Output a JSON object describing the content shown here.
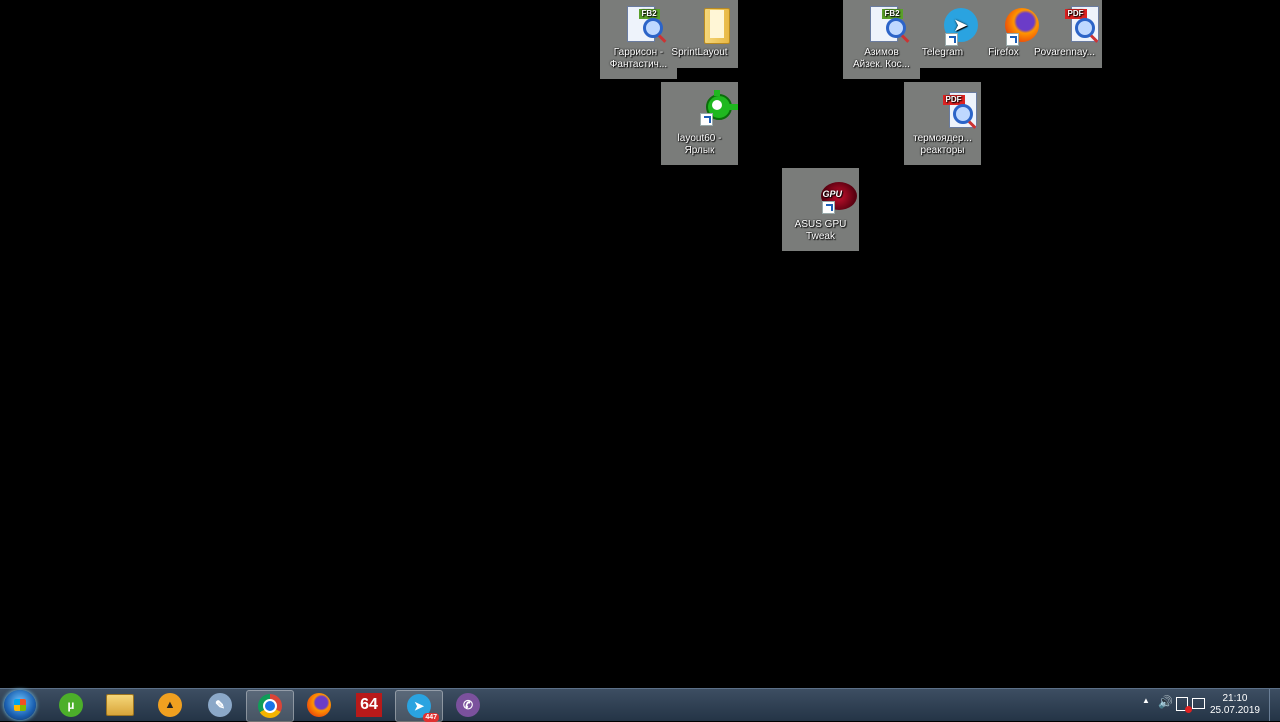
{
  "desktop": {
    "icons": [
      {
        "label1": "Гаррисон -",
        "label2": "Фантастич...",
        "type": "fb2"
      },
      {
        "label1": "SprintLayout",
        "label2": "",
        "type": "folder"
      },
      {
        "label1": "Азимов",
        "label2": "Айзек. Кос...",
        "type": "fb2"
      },
      {
        "label1": "Telegram",
        "label2": "",
        "type": "telegram"
      },
      {
        "label1": "Firefox",
        "label2": "",
        "type": "firefox"
      },
      {
        "label1": "Povarennay...",
        "label2": "",
        "type": "pdf"
      },
      {
        "label1": "layout60 -",
        "label2": "Ярлык",
        "type": "layout"
      },
      {
        "label1": "термоядер...",
        "label2": "реакторы",
        "type": "pdf"
      },
      {
        "label1": "ASUS GPU",
        "label2": "Tweak",
        "type": "gpu"
      }
    ],
    "badges": {
      "fb2": "FB2",
      "pdf": "PDF",
      "gpu": "GPU"
    }
  },
  "taskbar": {
    "pinned": [
      {
        "name": "utorrent",
        "glyph": "µ",
        "color": "#4caf2a"
      },
      {
        "name": "explorer",
        "glyph": "",
        "color": "#e8c054"
      },
      {
        "name": "aimp",
        "glyph": "▲",
        "color": "#f0a020"
      },
      {
        "name": "paint",
        "glyph": "✎",
        "color": "#8ba8c8"
      },
      {
        "name": "chrome",
        "glyph": "",
        "color": "#1a73e8"
      },
      {
        "name": "firefox",
        "glyph": "",
        "color": "#ff7a00"
      },
      {
        "name": "aida64",
        "glyph": "64",
        "color": "#b81a1a"
      },
      {
        "name": "telegram",
        "glyph": "➤",
        "color": "#2aa3e0"
      },
      {
        "name": "viber",
        "glyph": "✆",
        "color": "#7b519d"
      }
    ],
    "telegram_badge": "447",
    "tray": {
      "chevron": "▲",
      "volume": "🔊"
    },
    "clock": {
      "time": "21:10",
      "date": "25.07.2019"
    }
  }
}
